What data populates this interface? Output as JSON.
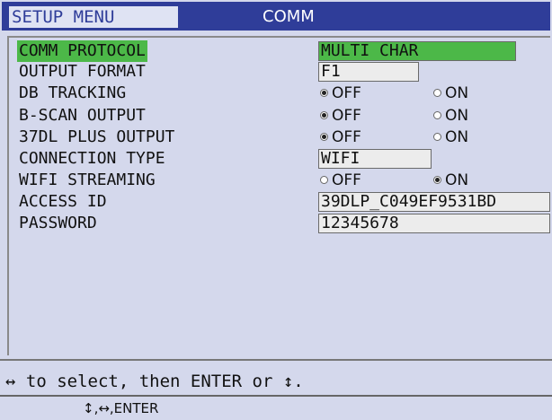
{
  "header": {
    "menu_label": "SETUP MENU",
    "title": "COMM"
  },
  "settings": [
    {
      "label": "COMM PROTOCOL",
      "type": "field",
      "value": "MULTI CHAR",
      "active": true
    },
    {
      "label": "OUTPUT FORMAT",
      "type": "field",
      "value": "F1"
    },
    {
      "label": "DB TRACKING",
      "type": "radio",
      "options": [
        "OFF",
        "ON"
      ],
      "selected": "OFF"
    },
    {
      "label": "B-SCAN OUTPUT",
      "type": "radio",
      "options": [
        "OFF",
        "ON"
      ],
      "selected": "OFF"
    },
    {
      "label": "37DL PLUS OUTPUT",
      "type": "radio",
      "options": [
        "OFF",
        "ON"
      ],
      "selected": "OFF"
    },
    {
      "label": "CONNECTION TYPE",
      "type": "field",
      "value": "WIFI"
    },
    {
      "label": "WIFI STREAMING",
      "type": "radio",
      "options": [
        "OFF",
        "ON"
      ],
      "selected": "ON"
    },
    {
      "label": "ACCESS ID",
      "type": "field",
      "value": "39DLP_C049EF9531BD"
    },
    {
      "label": "PASSWORD",
      "type": "field",
      "value": "12345678"
    }
  ],
  "footer": {
    "help_text": "↔ to select, then ENTER or ↕.",
    "key_hint": "↕,↔,ENTER"
  },
  "colors": {
    "title_bar": "#2f3d99",
    "highlight": "#4cb848",
    "background": "#d4d8ec"
  }
}
